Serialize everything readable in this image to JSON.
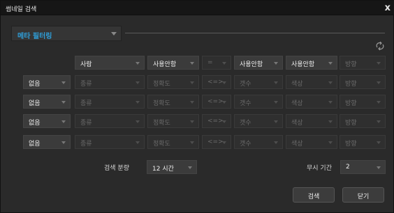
{
  "window": {
    "title": "썸네일 검색",
    "close_glyph": "x"
  },
  "meta_filter": {
    "label": "메타 필터링"
  },
  "icons": {
    "refresh": "refresh-icon",
    "colors": {
      "accent": "#2f9ed8",
      "background": "#2a2a2a",
      "titlebar": "#161616"
    }
  },
  "header_row": {
    "subject": "사람",
    "option1": "사용안함",
    "operator": "=",
    "option2": "사용안함",
    "option3": "사용안함",
    "direction": "방향"
  },
  "filter_rows": [
    {
      "condition": "없음",
      "type": "종류",
      "accuracy": "정확도",
      "operator": "<=>",
      "count": "갯수",
      "color": "색상",
      "direction": "방향"
    },
    {
      "condition": "없음",
      "type": "종류",
      "accuracy": "정확도",
      "operator": "<=>",
      "count": "갯수",
      "color": "색상",
      "direction": "방향"
    },
    {
      "condition": "없음",
      "type": "종류",
      "accuracy": "정확도",
      "operator": "<=>",
      "count": "갯수",
      "color": "색상",
      "direction": "방향"
    },
    {
      "condition": "없음",
      "type": "종류",
      "accuracy": "정확도",
      "operator": "<=>",
      "count": "갯수",
      "color": "색상",
      "direction": "방향"
    }
  ],
  "search_range": {
    "label": "검색 분량",
    "value": "12 시간"
  },
  "ignore_period": {
    "label": "무시 기간",
    "value": "2"
  },
  "buttons": {
    "search": "검색",
    "close": "닫기"
  }
}
